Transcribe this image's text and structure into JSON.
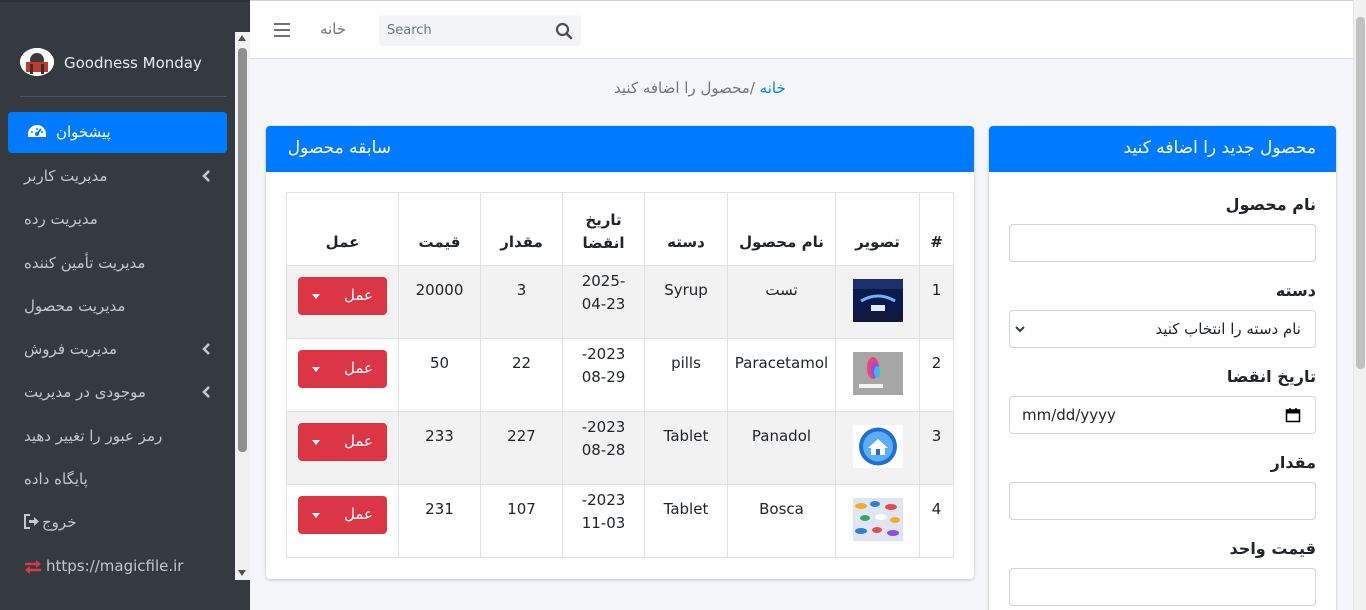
{
  "sidebar": {
    "brand": "Goodness Monday",
    "items": [
      {
        "label": "پیشخوان",
        "active": true,
        "icon": "tachometer-icon"
      },
      {
        "label": "مدیریت کاربر",
        "chevron": true
      },
      {
        "label": "مدیریت رده"
      },
      {
        "label": "مدیریت تأمین کننده"
      },
      {
        "label": "مدیریت محصول"
      },
      {
        "label": "مدیریت فروش",
        "chevron": true
      },
      {
        "label": "موجودی در مدیریت",
        "chevron": true
      },
      {
        "label": "رمز عبور را تغییر دهید"
      },
      {
        "label": "پایگاه داده"
      },
      {
        "label": "خروج",
        "icon": "sign-out-icon"
      },
      {
        "label": "https://magicfile.ir",
        "icon": "exchange-icon"
      }
    ]
  },
  "topnav": {
    "home": "خانه",
    "search_placeholder": "Search"
  },
  "breadcrumb": {
    "home": "خانه",
    "separator": " /",
    "current": "محصول را اضافه کنید"
  },
  "product_history": {
    "title": "سابقه محصول",
    "columns": [
      "#",
      "تصویر",
      "نام محصول",
      "دسته",
      "تاریخ انقضا",
      "مقدار",
      "قیمت",
      "عمل"
    ],
    "action_label": "عمل",
    "rows": [
      {
        "num": "1",
        "name": "تست",
        "category": "Syrup",
        "expiry_a": "2025-",
        "expiry_b": "04-23",
        "qty": "3",
        "price": "20000"
      },
      {
        "num": "2",
        "name": "Paracetamol",
        "category": "pills",
        "expiry_a": "2023-",
        "expiry_b": "08-29",
        "qty": "22",
        "price": "50"
      },
      {
        "num": "3",
        "name": "Panadol",
        "category": "Tablet",
        "expiry_a": "2023-",
        "expiry_b": "08-28",
        "qty": "227",
        "price": "233"
      },
      {
        "num": "4",
        "name": "Bosca",
        "category": "Tablet",
        "expiry_a": "2023-",
        "expiry_b": "11-03",
        "qty": "107",
        "price": "231"
      }
    ]
  },
  "add_product": {
    "title": "محصول جدید را اضافه کنید",
    "name_label": "نام محصول",
    "category_label": "دسته",
    "category_value": "نام دسته را انتخاب کنید",
    "expiry_label": "تاریخ انقضا",
    "expiry_placeholder": "mm/dd/yyyy",
    "qty_label": "مقدار",
    "unit_price_label": "قیمت واحد"
  },
  "colors": {
    "primary": "#007bff",
    "danger": "#dc3545",
    "sidebar": "#343a40"
  }
}
